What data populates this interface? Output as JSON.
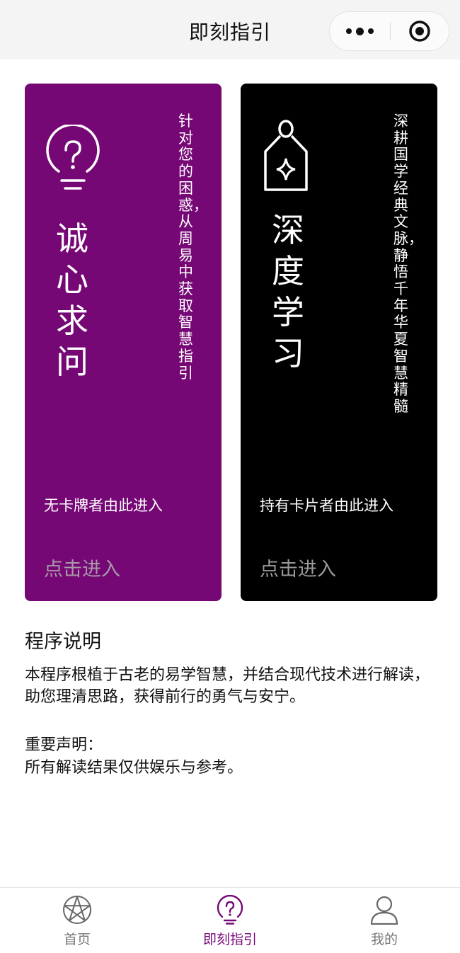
{
  "header": {
    "title": "即刻指引",
    "more_icon": "more-dots-icon",
    "close_icon": "target-close-icon"
  },
  "cards": [
    {
      "color": "#760876",
      "icon": "question-lightbulb-icon",
      "title": "诚心求问",
      "subtitle": "针对您的困惑，从周易中获取智慧指引",
      "hint": "无卡牌者由此进入",
      "button": "点击进入"
    },
    {
      "color": "#000000",
      "icon": "tag-sparkle-icon",
      "title": "深度学习",
      "subtitle": "深耕国学经典文脉，静悟千年华夏智慧精髓",
      "hint": "持有卡片者由此进入",
      "button": "点击进入"
    }
  ],
  "description": {
    "title": "程序说明",
    "body": "本程序根植于古老的易学智慧，并结合现代技术进行解读，助您理清思路，获得前行的勇气与安宁。",
    "notice_title": "重要声明：",
    "notice_body": "所有解读结果仅供娱乐与参考。"
  },
  "tabbar": {
    "accent": "#760876",
    "items": [
      {
        "label": "首页",
        "icon": "pentagram-icon",
        "active": false
      },
      {
        "label": "即刻指引",
        "icon": "question-lightbulb-icon",
        "active": true
      },
      {
        "label": "我的",
        "icon": "user-icon",
        "active": false
      }
    ]
  }
}
